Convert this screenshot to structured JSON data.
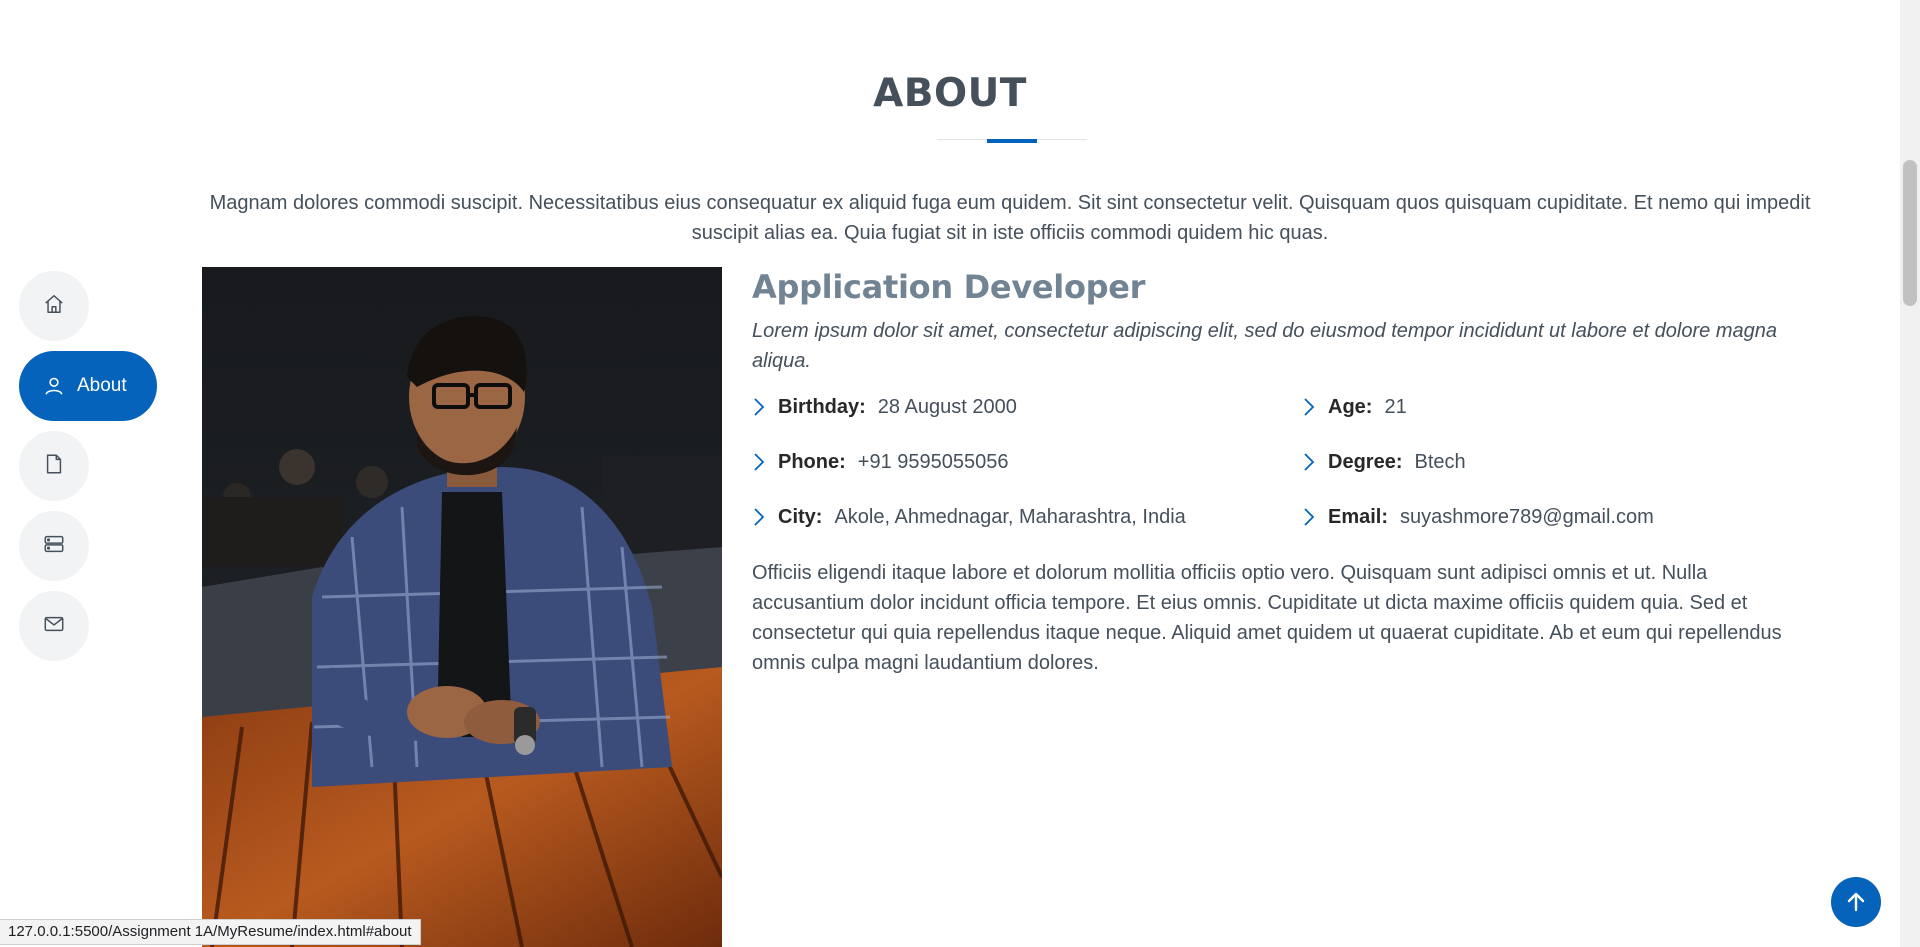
{
  "section": {
    "title": "ABOUT",
    "description": "Magnam dolores commodi suscipit. Necessitatibus eius consequatur ex aliquid fuga eum quidem. Sit sint consectetur velit. Quisquam quos quisquam cupiditate. Et nemo qui impedit suscipit alias ea. Quia fugiat sit in iste officiis commodi quidem hic quas."
  },
  "nav": {
    "items": [
      {
        "icon": "home-icon",
        "label": ""
      },
      {
        "icon": "person-icon",
        "label": "About",
        "active": true
      },
      {
        "icon": "file-icon",
        "label": ""
      },
      {
        "icon": "server-icon",
        "label": ""
      },
      {
        "icon": "envelope-icon",
        "label": ""
      }
    ]
  },
  "profile": {
    "role": "Application Developer",
    "lead": "Lorem ipsum dolor sit amet, consectetur adipiscing elit, sed do eiusmod tempor incididunt ut labore et dolore magna aliqua.",
    "details": [
      {
        "key": "Birthday:",
        "value": "28 August 2000"
      },
      {
        "key": "Age:",
        "value": "21"
      },
      {
        "key": "Phone:",
        "value": "+91 9595055056"
      },
      {
        "key": "Degree:",
        "value": "Btech"
      },
      {
        "key": "City:",
        "value": "Akole, Ahmednagar, Maharashtra, India"
      },
      {
        "key": "Email:",
        "value": "suyashmore789@gmail.com"
      }
    ],
    "body": "Officiis eligendi itaque labore et dolorum mollitia officiis optio vero. Quisquam sunt adipisci omnis et ut. Nulla accusantium dolor incidunt officia tempore. Et eius omnis. Cupiditate ut dicta maxime officiis quidem quia. Sed et consectetur qui quia repellendus itaque neque. Aliquid amet quidem ut quaerat cupiditate. Ab et eum qui repellendus omnis culpa magni laudantium dolores."
  },
  "status_url": "127.0.0.1:5500/Assignment 1A/MyResume/index.html#about",
  "colors": {
    "accent": "#0563bb",
    "heading": "#45505b",
    "role": "#728394"
  }
}
